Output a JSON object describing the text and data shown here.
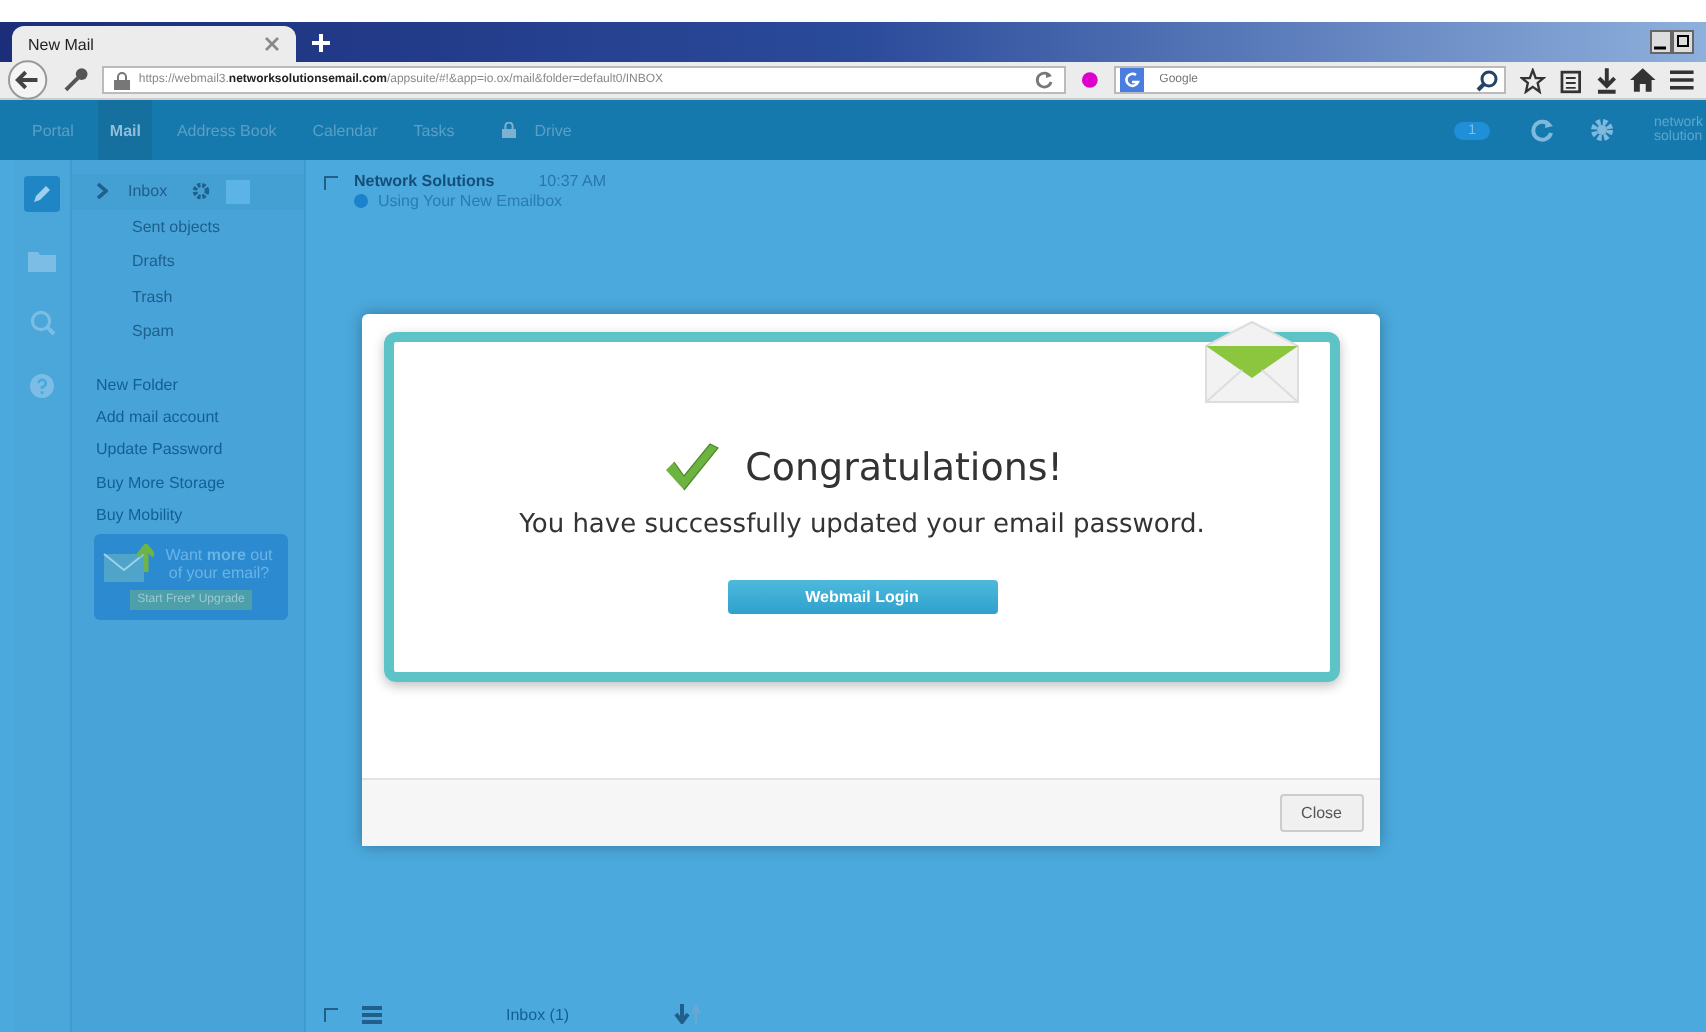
{
  "browser": {
    "tab_title": "New Mail",
    "url_prefix": "https://webmail3.",
    "url_domain": "networksolutionsemail.com",
    "url_rest": "/appsuite/#!&app=io.ox/mail&folder=default0/INBOX",
    "search_placeholder": "Google"
  },
  "app_nav": {
    "items": [
      {
        "label": "Portal",
        "selected": false,
        "locked": false
      },
      {
        "label": "Mail",
        "selected": true,
        "locked": false
      },
      {
        "label": "Address Book",
        "selected": false,
        "locked": false
      },
      {
        "label": "Calendar",
        "selected": false,
        "locked": false
      },
      {
        "label": "Tasks",
        "selected": false,
        "locked": false
      },
      {
        "label": "Drive",
        "selected": false,
        "locked": true
      }
    ],
    "badge": "1",
    "logo_lines": [
      "network",
      "solution"
    ]
  },
  "folders": [
    {
      "label": "Inbox",
      "selected": true
    },
    {
      "label": "Sent objects",
      "selected": false
    },
    {
      "label": "Drafts",
      "selected": false
    },
    {
      "label": "Trash",
      "selected": false
    },
    {
      "label": "Spam",
      "selected": false
    }
  ],
  "folder_links": [
    "New Folder",
    "Add mail account",
    "Update Password",
    "Buy More Storage",
    "Buy Mobility"
  ],
  "promo": {
    "text": "Want **more** out of your email?",
    "button": "Start Free* Upgrade"
  },
  "mails": [
    {
      "sender": "Network Solutions",
      "time": "10:37 AM",
      "subject": "Using Your New Emailbox",
      "unread": true,
      "checked": false
    }
  ],
  "list_footer": {
    "folder": "Inbox (1)",
    "select_all_checked": false
  },
  "dialog": {
    "title": "Congratulations!",
    "message": "You have successfully updated your email password.",
    "login_button": "Webmail Login",
    "close_button": "Close"
  }
}
